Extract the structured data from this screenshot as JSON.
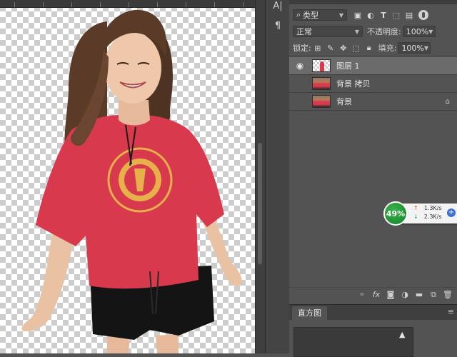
{
  "layers_panel": {
    "filter_kind": "类型",
    "blend_mode": "正常",
    "opacity_label": "不透明度:",
    "opacity_value": "100%",
    "lock_label": "锁定:",
    "fill_label": "填充:",
    "fill_value": "100%",
    "layers": [
      {
        "name": "图层 1",
        "visible": true,
        "selected": true,
        "locked": false
      },
      {
        "name": "背景 拷贝",
        "visible": false,
        "selected": false,
        "locked": false
      },
      {
        "name": "背景",
        "visible": false,
        "selected": false,
        "locked": true
      }
    ]
  },
  "histogram": {
    "tab_label": "直方图"
  },
  "network_widget": {
    "percent": "49%",
    "upload": "1.3K/s",
    "download": "2.3K/s"
  },
  "icons": {
    "filter_search": "⌕",
    "eye": "👁",
    "lock": "🔒"
  },
  "colors": {
    "panel_bg": "#535353",
    "selected_layer": "#6b6b6b",
    "shirt": "#d8394d",
    "widget_green": "#1f9a36"
  }
}
